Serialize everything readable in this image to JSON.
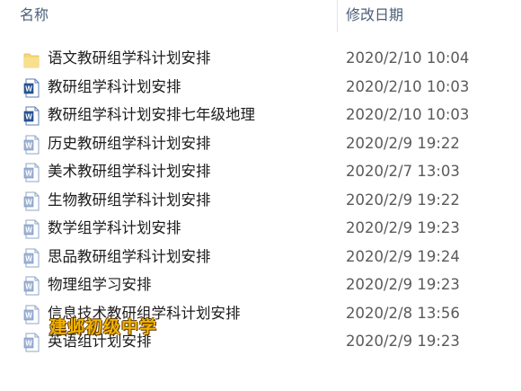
{
  "columns": {
    "name_label": "名称",
    "date_label": "修改日期"
  },
  "files": [
    {
      "name": "语文教研组学科计划安排",
      "date": "2020/2/10 10:04",
      "type": "folder"
    },
    {
      "name": "教研组学科计划安排",
      "date": "2020/2/10 10:03",
      "type": "word-doc"
    },
    {
      "name": "教研组学科计划安排七年级地理",
      "date": "2020/2/10 10:03",
      "type": "word-doc"
    },
    {
      "name": "历史教研组学科计划安排",
      "date": "2020/2/9 19:22",
      "type": "word-doc-light"
    },
    {
      "name": "美术教研组学科计划安排",
      "date": "2020/2/7 13:03",
      "type": "word-doc-light"
    },
    {
      "name": "生物教研组学科计划安排",
      "date": "2020/2/9 19:22",
      "type": "word-doc-light"
    },
    {
      "name": "数学组学科计划安排",
      "date": "2020/2/9 19:23",
      "type": "word-doc-light"
    },
    {
      "name": "思品教研组学科计划安排",
      "date": "2020/2/9 19:24",
      "type": "word-doc-light"
    },
    {
      "name": "物理组学习安排",
      "date": "2020/2/9 19:23",
      "type": "word-doc-light"
    },
    {
      "name": "信息技术教研组学科计划安排",
      "date": "2020/2/8 13:56",
      "type": "word-doc-light"
    },
    {
      "name": "英语组计划安排",
      "date": "2020/2/9 19:23",
      "type": "word-doc-light"
    }
  ],
  "watermark": "建邺初级中学",
  "colors": {
    "header_text": "#4c607a",
    "folder": "#f5d67a",
    "word_icon": "#2b5797",
    "watermark": "#f2b400"
  }
}
